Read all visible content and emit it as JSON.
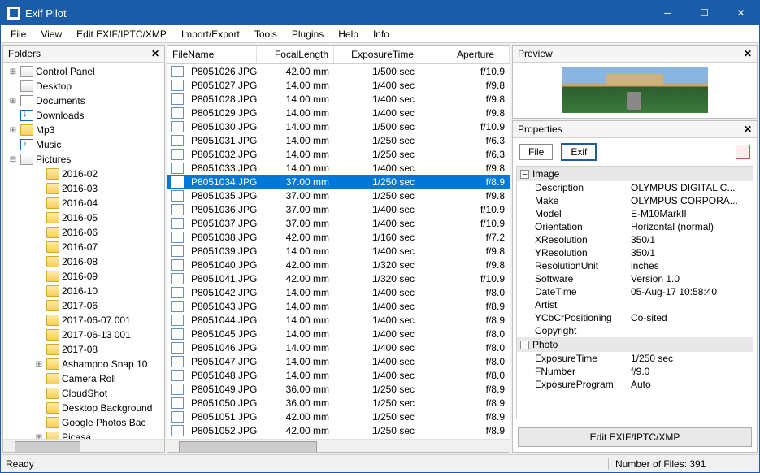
{
  "window": {
    "title": "Exif Pilot"
  },
  "menu": [
    "File",
    "View",
    "Edit EXIF/IPTC/XMP",
    "Import/Export",
    "Tools",
    "Plugins",
    "Help",
    "Info"
  ],
  "panels": {
    "folders": "Folders",
    "preview": "Preview",
    "properties": "Properties"
  },
  "tree": [
    {
      "depth": 0,
      "exp": "+",
      "icon": "folder-b",
      "label": "Control Panel"
    },
    {
      "depth": 0,
      "exp": "",
      "icon": "folder-b",
      "label": "Desktop"
    },
    {
      "depth": 0,
      "exp": "+",
      "icon": "doc-ic",
      "label": "Documents"
    },
    {
      "depth": 0,
      "exp": "",
      "icon": "dl-ic",
      "label": "Downloads"
    },
    {
      "depth": 0,
      "exp": "+",
      "icon": "folder-y",
      "label": "Mp3"
    },
    {
      "depth": 0,
      "exp": "",
      "icon": "music-ic",
      "label": "Music"
    },
    {
      "depth": 0,
      "exp": "–",
      "icon": "folder-b",
      "label": "Pictures"
    },
    {
      "depth": 1,
      "exp": "",
      "icon": "folder-y",
      "label": "2016-02"
    },
    {
      "depth": 1,
      "exp": "",
      "icon": "folder-y",
      "label": "2016-03"
    },
    {
      "depth": 1,
      "exp": "",
      "icon": "folder-y",
      "label": "2016-04"
    },
    {
      "depth": 1,
      "exp": "",
      "icon": "folder-y",
      "label": "2016-05"
    },
    {
      "depth": 1,
      "exp": "",
      "icon": "folder-y",
      "label": "2016-06"
    },
    {
      "depth": 1,
      "exp": "",
      "icon": "folder-y",
      "label": "2016-07"
    },
    {
      "depth": 1,
      "exp": "",
      "icon": "folder-y",
      "label": "2016-08"
    },
    {
      "depth": 1,
      "exp": "",
      "icon": "folder-y",
      "label": "2016-09"
    },
    {
      "depth": 1,
      "exp": "",
      "icon": "folder-y",
      "label": "2016-10"
    },
    {
      "depth": 1,
      "exp": "",
      "icon": "folder-y",
      "label": "2017-06"
    },
    {
      "depth": 1,
      "exp": "",
      "icon": "folder-y",
      "label": "2017-06-07 001"
    },
    {
      "depth": 1,
      "exp": "",
      "icon": "folder-y",
      "label": "2017-06-13 001"
    },
    {
      "depth": 1,
      "exp": "",
      "icon": "folder-y",
      "label": "2017-08"
    },
    {
      "depth": 1,
      "exp": "+",
      "icon": "folder-y",
      "label": "Ashampoo Snap 10"
    },
    {
      "depth": 1,
      "exp": "",
      "icon": "folder-y",
      "label": "Camera Roll"
    },
    {
      "depth": 1,
      "exp": "",
      "icon": "folder-y",
      "label": "CloudShot"
    },
    {
      "depth": 1,
      "exp": "",
      "icon": "folder-y",
      "label": "Desktop Background"
    },
    {
      "depth": 1,
      "exp": "",
      "icon": "folder-y",
      "label": "Google Photos Bac"
    },
    {
      "depth": 1,
      "exp": "+",
      "icon": "folder-y",
      "label": "Picasa"
    }
  ],
  "columns": {
    "filename": "FileName",
    "focal": "FocalLength",
    "exposure": "ExposureTime",
    "aperture": "Aperture"
  },
  "files": [
    {
      "n": "P8051026.JPG",
      "f": "42.00 mm",
      "e": "1/500 sec",
      "a": "f/10.9"
    },
    {
      "n": "P8051027.JPG",
      "f": "14.00 mm",
      "e": "1/400 sec",
      "a": "f/9.8"
    },
    {
      "n": "P8051028.JPG",
      "f": "14.00 mm",
      "e": "1/400 sec",
      "a": "f/9.8"
    },
    {
      "n": "P8051029.JPG",
      "f": "14.00 mm",
      "e": "1/400 sec",
      "a": "f/9.8"
    },
    {
      "n": "P8051030.JPG",
      "f": "14.00 mm",
      "e": "1/500 sec",
      "a": "f/10.9"
    },
    {
      "n": "P8051031.JPG",
      "f": "14.00 mm",
      "e": "1/250 sec",
      "a": "f/6.3"
    },
    {
      "n": "P8051032.JPG",
      "f": "14.00 mm",
      "e": "1/250 sec",
      "a": "f/6.3"
    },
    {
      "n": "P8051033.JPG",
      "f": "14.00 mm",
      "e": "1/400 sec",
      "a": "f/9.8"
    },
    {
      "n": "P8051034.JPG",
      "f": "37.00 mm",
      "e": "1/250 sec",
      "a": "f/8.9",
      "sel": true
    },
    {
      "n": "P8051035.JPG",
      "f": "37.00 mm",
      "e": "1/250 sec",
      "a": "f/9.8"
    },
    {
      "n": "P8051036.JPG",
      "f": "37.00 mm",
      "e": "1/400 sec",
      "a": "f/10.9"
    },
    {
      "n": "P8051037.JPG",
      "f": "37.00 mm",
      "e": "1/400 sec",
      "a": "f/10.9"
    },
    {
      "n": "P8051038.JPG",
      "f": "42.00 mm",
      "e": "1/160 sec",
      "a": "f/7.2"
    },
    {
      "n": "P8051039.JPG",
      "f": "14.00 mm",
      "e": "1/400 sec",
      "a": "f/9.8"
    },
    {
      "n": "P8051040.JPG",
      "f": "42.00 mm",
      "e": "1/320 sec",
      "a": "f/9.8"
    },
    {
      "n": "P8051041.JPG",
      "f": "42.00 mm",
      "e": "1/320 sec",
      "a": "f/10.9"
    },
    {
      "n": "P8051042.JPG",
      "f": "14.00 mm",
      "e": "1/400 sec",
      "a": "f/8.0"
    },
    {
      "n": "P8051043.JPG",
      "f": "14.00 mm",
      "e": "1/400 sec",
      "a": "f/8.9"
    },
    {
      "n": "P8051044.JPG",
      "f": "14.00 mm",
      "e": "1/400 sec",
      "a": "f/8.9"
    },
    {
      "n": "P8051045.JPG",
      "f": "14.00 mm",
      "e": "1/400 sec",
      "a": "f/8.0"
    },
    {
      "n": "P8051046.JPG",
      "f": "14.00 mm",
      "e": "1/400 sec",
      "a": "f/8.0"
    },
    {
      "n": "P8051047.JPG",
      "f": "14.00 mm",
      "e": "1/400 sec",
      "a": "f/8.0"
    },
    {
      "n": "P8051048.JPG",
      "f": "14.00 mm",
      "e": "1/400 sec",
      "a": "f/8.0"
    },
    {
      "n": "P8051049.JPG",
      "f": "36.00 mm",
      "e": "1/250 sec",
      "a": "f/8.9"
    },
    {
      "n": "P8051050.JPG",
      "f": "36.00 mm",
      "e": "1/250 sec",
      "a": "f/8.9"
    },
    {
      "n": "P8051051.JPG",
      "f": "42.00 mm",
      "e": "1/250 sec",
      "a": "f/8.9"
    },
    {
      "n": "P8051052.JPG",
      "f": "42.00 mm",
      "e": "1/250 sec",
      "a": "f/8.9"
    }
  ],
  "propsTabs": {
    "file": "File",
    "exif": "Exif"
  },
  "propGroups": [
    {
      "title": "Image",
      "rows": [
        {
          "k": "Description",
          "v": "OLYMPUS DIGITAL C..."
        },
        {
          "k": "Make",
          "v": "OLYMPUS CORPORA..."
        },
        {
          "k": "Model",
          "v": "E-M10MarkII"
        },
        {
          "k": "Orientation",
          "v": "Horizontal (normal)"
        },
        {
          "k": "XResolution",
          "v": "350/1"
        },
        {
          "k": "YResolution",
          "v": "350/1"
        },
        {
          "k": "ResolutionUnit",
          "v": "inches"
        },
        {
          "k": "Software",
          "v": "Version 1.0"
        },
        {
          "k": "DateTime",
          "v": "05-Aug-17 10:58:40"
        },
        {
          "k": "Artist",
          "v": ""
        },
        {
          "k": "YCbCrPositioning",
          "v": "Co-sited"
        },
        {
          "k": "Copyright",
          "v": ""
        }
      ]
    },
    {
      "title": "Photo",
      "rows": [
        {
          "k": "ExposureTime",
          "v": "1/250 sec"
        },
        {
          "k": "FNumber",
          "v": "f/9.0"
        },
        {
          "k": "ExposureProgram",
          "v": "Auto"
        }
      ]
    }
  ],
  "editButton": "Edit EXIF/IPTC/XMP",
  "status": {
    "left": "Ready",
    "right": "Number of Files: 391"
  }
}
